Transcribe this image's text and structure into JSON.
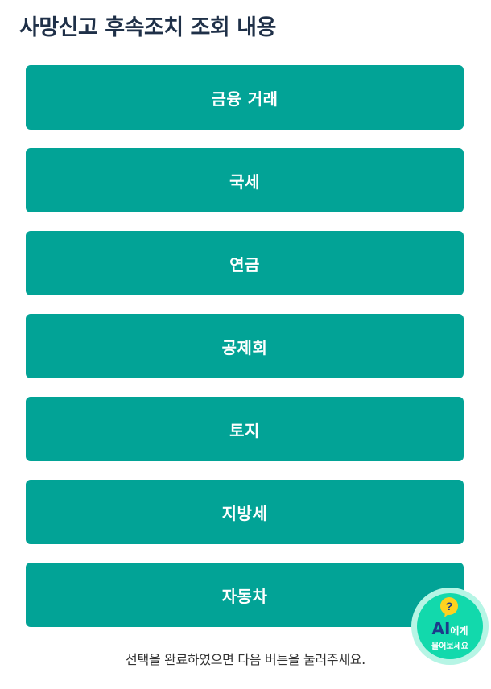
{
  "page": {
    "title": "사망신고 후속조치 조회 내용"
  },
  "menu": {
    "items": [
      {
        "label": "금융 거래"
      },
      {
        "label": "국세"
      },
      {
        "label": "연금"
      },
      {
        "label": "공제회"
      },
      {
        "label": "토지"
      },
      {
        "label": "지방세"
      },
      {
        "label": "자동차"
      }
    ]
  },
  "footer": {
    "instruction": "선택을 완료하였으면 다음 버튼을 눌러주세요."
  },
  "ai_widget": {
    "icon": "question-bubble-icon",
    "label_strong": "AI",
    "label_suffix": "에게",
    "label_sub": "물어보세요"
  },
  "colors": {
    "button_bg": "#02a396",
    "title": "#1f3048",
    "ai_outer": "#b6f5e5",
    "ai_inner": "#12d9ac"
  }
}
